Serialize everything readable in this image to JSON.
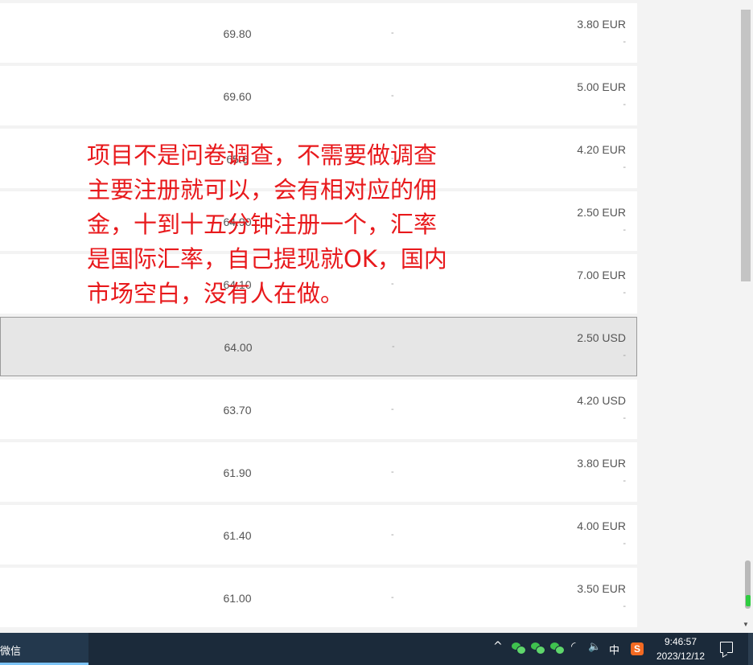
{
  "rows": [
    {
      "score": "69.80",
      "mid": "-",
      "price": "3.80 EUR",
      "sub": "-"
    },
    {
      "score": "69.60",
      "mid": "-",
      "price": "5.00 EUR",
      "sub": "-"
    },
    {
      "score": "65.6",
      "mid": "-",
      "price": "4.20 EUR",
      "sub": "-"
    },
    {
      "score": "64.90",
      "mid": "-",
      "price": "2.50 EUR",
      "sub": "-"
    },
    {
      "score": "64.10",
      "mid": "-",
      "price": "7.00 EUR",
      "sub": "-"
    },
    {
      "score": "64.00",
      "mid": "-",
      "price": "2.50 USD",
      "sub": "-"
    },
    {
      "score": "63.70",
      "mid": "-",
      "price": "4.20 USD",
      "sub": "-"
    },
    {
      "score": "61.90",
      "mid": "-",
      "price": "3.80 EUR",
      "sub": "-"
    },
    {
      "score": "61.40",
      "mid": "-",
      "price": "4.00 EUR",
      "sub": "-"
    },
    {
      "score": "61.00",
      "mid": "-",
      "price": "3.50 EUR",
      "sub": "-"
    }
  ],
  "selected_row_index": 5,
  "overlay": {
    "lines": [
      "项目不是问卷调查，不需要做调查",
      "主要注册就可以，会有相对应的佣",
      "金，十到十五分钟注册一个，汇率",
      "是国际汇率，自己提现就OK，国内",
      "市场空白，没有人在做。"
    ],
    "color": "#e8191c"
  },
  "taskbar": {
    "app_label": "微信",
    "ime_label": "中",
    "sogou_label": "S",
    "chevron": "^",
    "wifi": "◜",
    "volume": "🔈",
    "clock_time": "9:46:57",
    "clock_date": "2023/12/12"
  },
  "scrollbar": {
    "down_arrow": "▼"
  }
}
